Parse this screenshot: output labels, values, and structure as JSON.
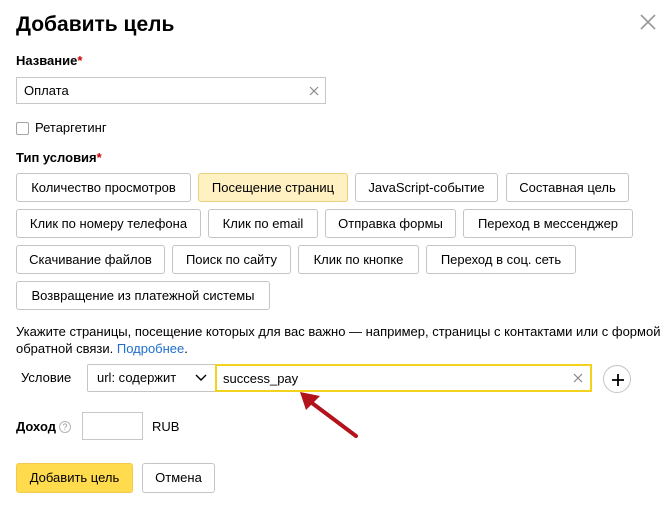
{
  "dialog": {
    "title": "Добавить цель",
    "close_icon": "close-icon"
  },
  "name": {
    "label": "Название",
    "required_mark": "*",
    "value": "Оплата"
  },
  "retargeting": {
    "label": "Ретаргетинг",
    "checked": false
  },
  "condition_type": {
    "label": "Тип условия",
    "required_mark": "*",
    "selected": "Посещение страниц",
    "options": [
      "Количество просмотров",
      "Посещение страниц",
      "JavaScript-событие",
      "Составная цель",
      "Клик по номеру телефона",
      "Клик по email",
      "Отправка формы",
      "Переход в мессенджер",
      "Скачивание файлов",
      "Поиск по сайту",
      "Клик по кнопке",
      "Переход в соц. сеть",
      "Возвращение из платежной системы"
    ]
  },
  "hint": {
    "text": "Укажите страницы, посещение которых для вас важно — например, страницы с контактами или с формой обратной связи. ",
    "link": "Подробнее",
    "end": "."
  },
  "condition": {
    "label": "Условие",
    "match_type": "url: содержит",
    "value": "success_pay"
  },
  "income": {
    "label": "Доход",
    "help": "?",
    "value": "",
    "currency": "RUB"
  },
  "buttons": {
    "submit": "Добавить цель",
    "cancel": "Отмена"
  },
  "colors": {
    "accent": "#ffdb4d",
    "selected_chip": "#fff1c2",
    "focus_border": "#f2d21d",
    "link": "#1f6fcf",
    "required": "#cc0000",
    "annotation_arrow": "#b3141b"
  }
}
